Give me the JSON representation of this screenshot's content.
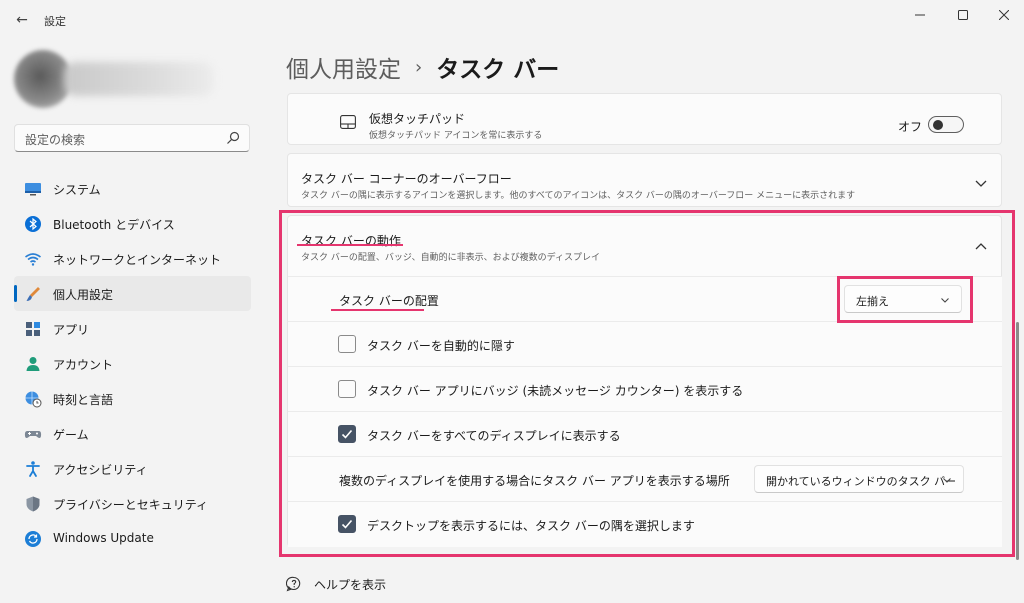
{
  "window": {
    "app_title": "設定",
    "back_glyph": "←",
    "minimize_glyph": "—",
    "close_glyph": "✕"
  },
  "search": {
    "placeholder": "設定の検索",
    "icon": "search-icon"
  },
  "sidebar": {
    "items": [
      {
        "label": "システム",
        "icon": "monitor-icon",
        "active": false
      },
      {
        "label": "Bluetooth とデバイス",
        "icon": "bluetooth-icon",
        "active": false
      },
      {
        "label": "ネットワークとインターネット",
        "icon": "wifi-icon",
        "active": false
      },
      {
        "label": "個人用設定",
        "icon": "brush-icon",
        "active": true
      },
      {
        "label": "アプリ",
        "icon": "apps-icon",
        "active": false
      },
      {
        "label": "アカウント",
        "icon": "person-icon",
        "active": false
      },
      {
        "label": "時刻と言語",
        "icon": "globe-clock-icon",
        "active": false
      },
      {
        "label": "ゲーム",
        "icon": "gamepad-icon",
        "active": false
      },
      {
        "label": "アクセシビリティ",
        "icon": "accessibility-icon",
        "active": false
      },
      {
        "label": "プライバシーとセキュリティ",
        "icon": "shield-icon",
        "active": false
      },
      {
        "label": "Windows Update",
        "icon": "sync-icon",
        "active": false
      }
    ]
  },
  "header": {
    "parent": "個人用設定",
    "separator": "›",
    "current": "タスク バー"
  },
  "touchpad": {
    "title": "仮想タッチパッド",
    "subtitle": "仮想タッチパッド アイコンを常に表示する",
    "toggle_label": "オフ",
    "toggle_on": false,
    "icon": "touchpad-icon"
  },
  "overflow": {
    "title": "タスク バー コーナーのオーバーフロー",
    "subtitle": "タスク バーの隅に表示するアイコンを選択します。他のすべてのアイコンは、タスク バーの隅のオーバーフロー メニューに表示されます",
    "expanded": false
  },
  "behaviors": {
    "title": "タスク バーの動作",
    "subtitle": "タスク バーの配置、バッジ、自動的に非表示、および複数のディスプレイ",
    "expanded": true,
    "alignment": {
      "label": "タスク バーの配置",
      "value": "左揃え"
    },
    "options": [
      {
        "label": "タスク バーを自動的に隠す",
        "checked": false
      },
      {
        "label": "タスク バー アプリにバッジ (未読メッセージ カウンター) を表示する",
        "checked": false
      },
      {
        "label": "タスク バーをすべてのディスプレイに表示する",
        "checked": true
      }
    ],
    "multi_display": {
      "label": "複数のディスプレイを使用する場合にタスク バー アプリを表示する場所",
      "value": "開かれているウィンドウのタスク バー"
    },
    "desktop_corner": {
      "label": "デスクトップを表示するには、タスク バーの隅を選択します",
      "checked": true
    }
  },
  "help": {
    "label": "ヘルプを表示",
    "icon": "help-icon"
  },
  "colors": {
    "highlight": "#e5356e",
    "accent": "#0067c0",
    "checkbox_checked": "#465365"
  }
}
